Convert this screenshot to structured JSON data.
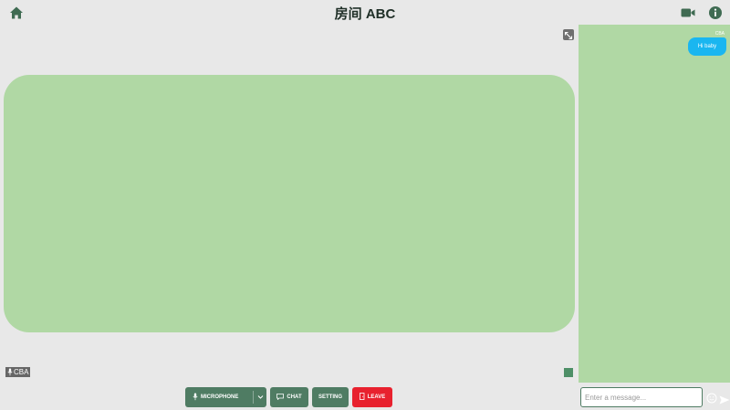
{
  "header": {
    "title": "房间 ABC",
    "home_icon": "home-icon",
    "video_icon": "video-camera-icon",
    "info_icon": "info-icon"
  },
  "stage": {
    "expand_icon": "expand-icon",
    "local_user_label": "CBA",
    "layout_icon": "layout-icon"
  },
  "controls": {
    "microphone_label": "MICROPHONE",
    "chat_label": "CHAT",
    "setting_label": "SETTING",
    "leave_label": "LEAVE"
  },
  "chat": {
    "messages": [
      {
        "sender": "CBA",
        "text": "Hi baby"
      }
    ],
    "input_placeholder": "Enter a message...",
    "emoji_icon": "emoji-icon",
    "send_icon": "send-icon"
  },
  "colors": {
    "background": "#e8e8e8",
    "tile": "#b0d8a4",
    "primary_button": "#4f7c63",
    "leave_button": "#e8212e",
    "bubble": "#1ab6f0"
  }
}
